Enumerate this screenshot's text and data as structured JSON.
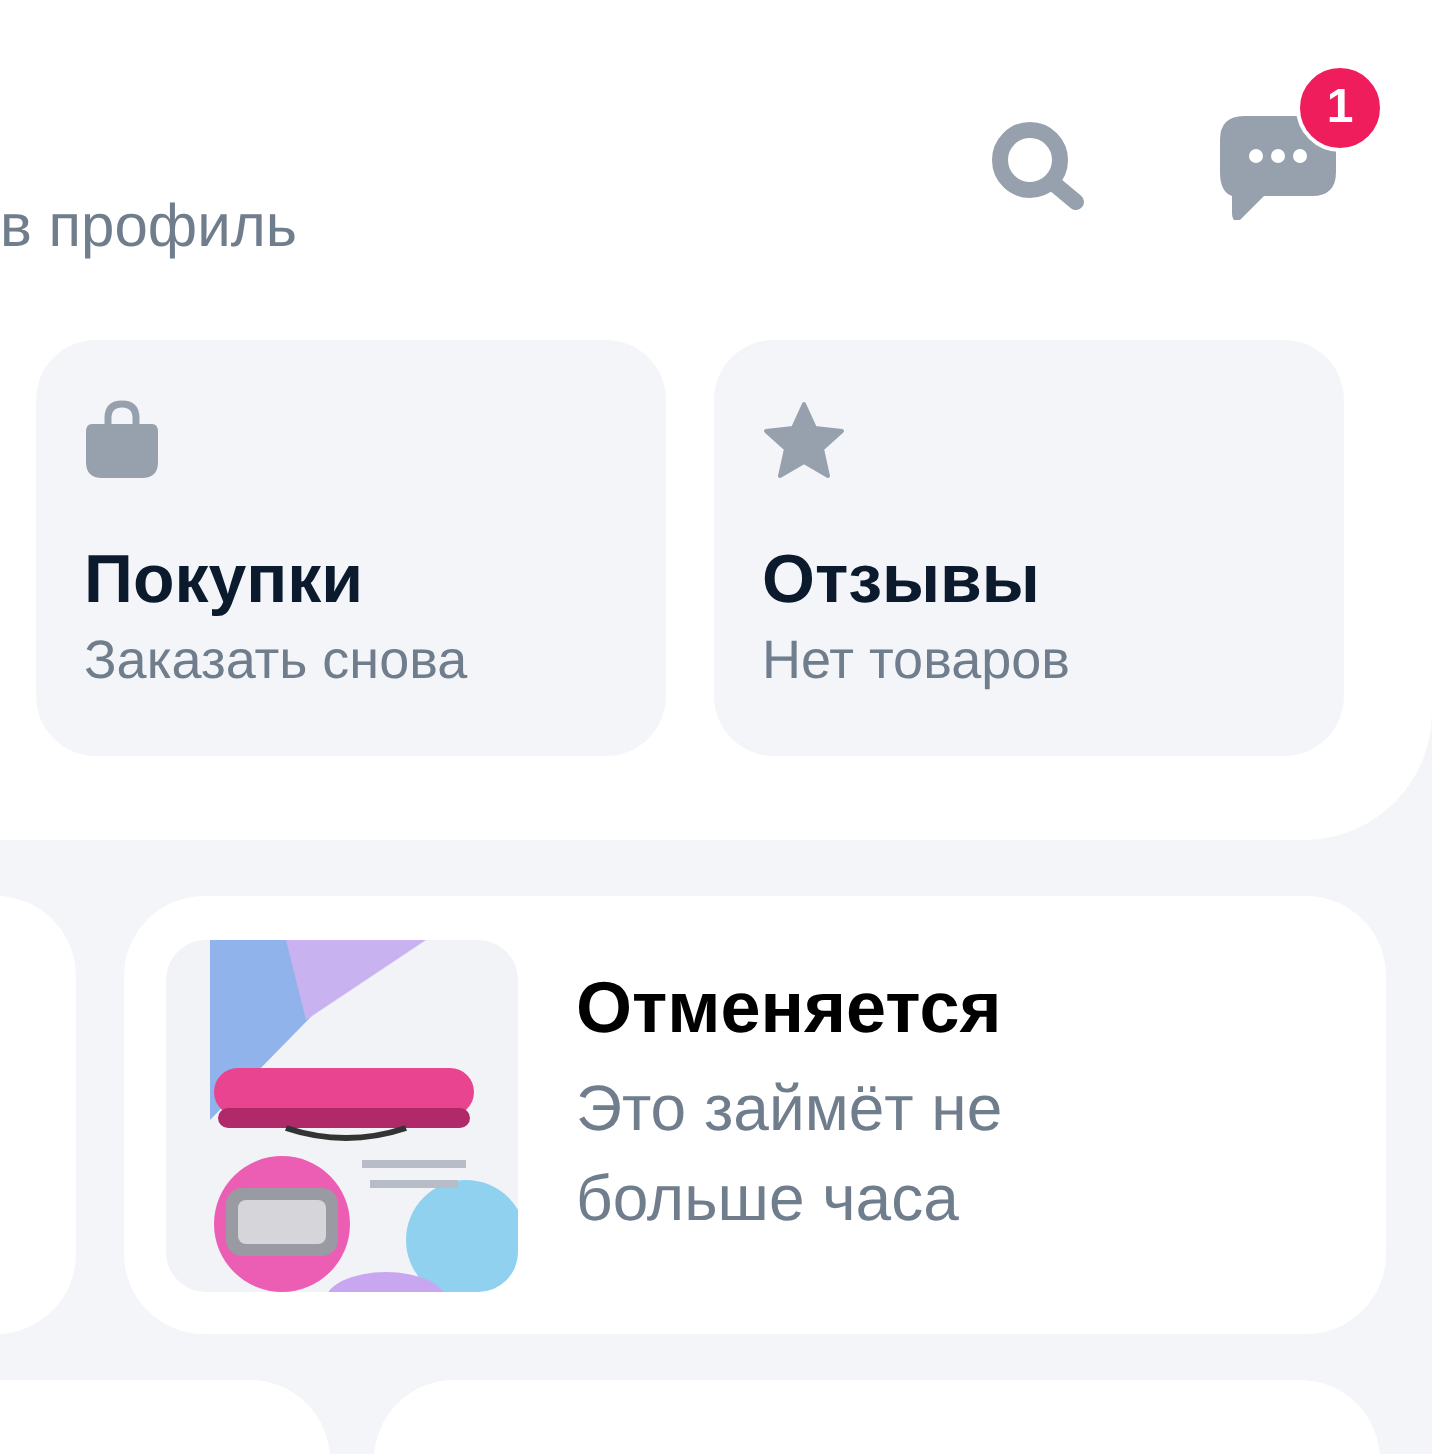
{
  "header": {
    "profile_link": "в профиль",
    "notifications_badge": "1"
  },
  "tiles": [
    {
      "kind": "bag",
      "title": "Покупки",
      "subtitle": "Заказать снова"
    },
    {
      "kind": "star",
      "title": "Отзывы",
      "subtitle": "Нет товаров"
    }
  ],
  "orders": [
    {
      "status": "Отменяется",
      "note": "Это займёт не больше часа"
    }
  ]
}
